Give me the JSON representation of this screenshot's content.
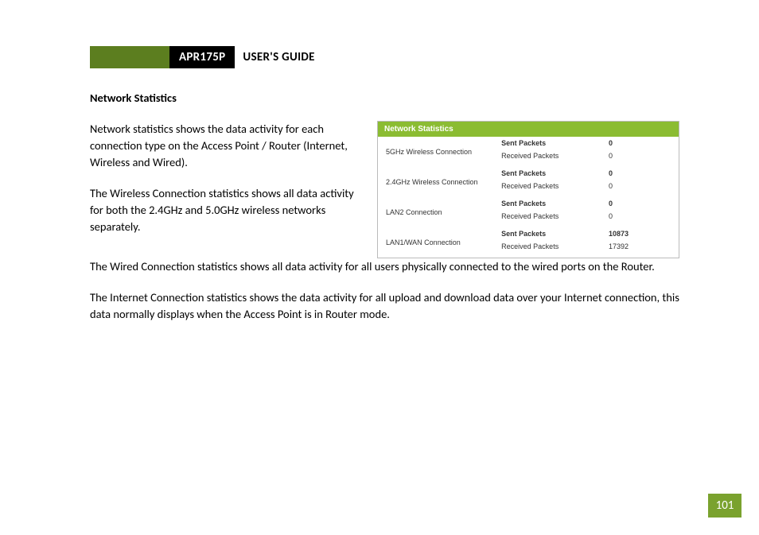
{
  "header": {
    "model": "APR175P",
    "guide": "USER'S GUIDE"
  },
  "section_title": "Network Statistics",
  "paragraphs": {
    "p1": "Network statistics shows the data activity for each connection type on the Access Point / Router (Internet, Wireless and Wired).",
    "p2": "The Wireless Connection statistics shows all data activity for both the 2.4GHz and 5.0GHz wireless networks separately.",
    "p3": "The Wired Connection statistics shows all data activity for all users physically connected to the wired ports on the Router.",
    "p4": "The Internet Connection statistics shows the data activity for all upload and download data over your Internet connection, this data normally displays when the Access Point is in Router mode."
  },
  "screenshot": {
    "title": "Network Statistics",
    "labels": {
      "sent": "Sent Packets",
      "recv": "Received Packets"
    },
    "rows": [
      {
        "name": "5GHz Wireless Connection",
        "sent": "0",
        "recv": "0"
      },
      {
        "name": "2.4GHz Wireless Connection",
        "sent": "0",
        "recv": "0"
      },
      {
        "name": "LAN2 Connection",
        "sent": "0",
        "recv": "0"
      },
      {
        "name": "LAN1/WAN Connection",
        "sent": "10873",
        "recv": "17392"
      }
    ]
  },
  "page_number": "101"
}
